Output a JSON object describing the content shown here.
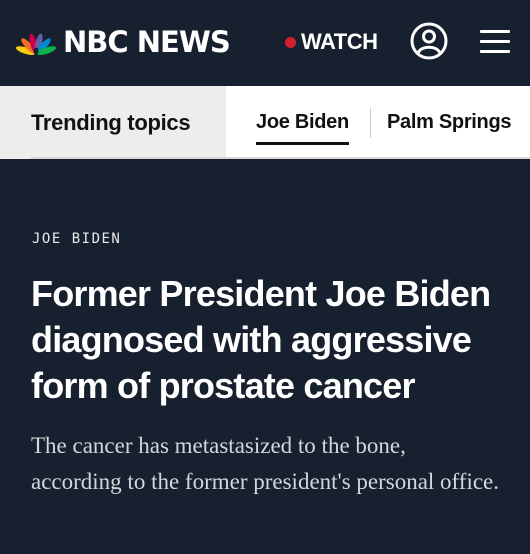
{
  "header": {
    "brand": "NBC NEWS",
    "watch_label": "WATCH",
    "icons": {
      "logo": "peacock-logo",
      "account": "account-icon",
      "menu": "hamburger-menu-icon"
    },
    "colors": {
      "background": "#17202f",
      "live_dot": "#d2202b"
    }
  },
  "trending": {
    "label": "Trending topics",
    "items": [
      {
        "label": "Joe Biden",
        "active": true
      },
      {
        "label": "Palm Springs",
        "active": false
      }
    ]
  },
  "article": {
    "eyebrow": "JOE BIDEN",
    "headline": "Former President Joe Biden diagnosed with aggressive form of prostate cancer",
    "dek": "The cancer has metastasized to the bone, according to the former president's personal office."
  }
}
